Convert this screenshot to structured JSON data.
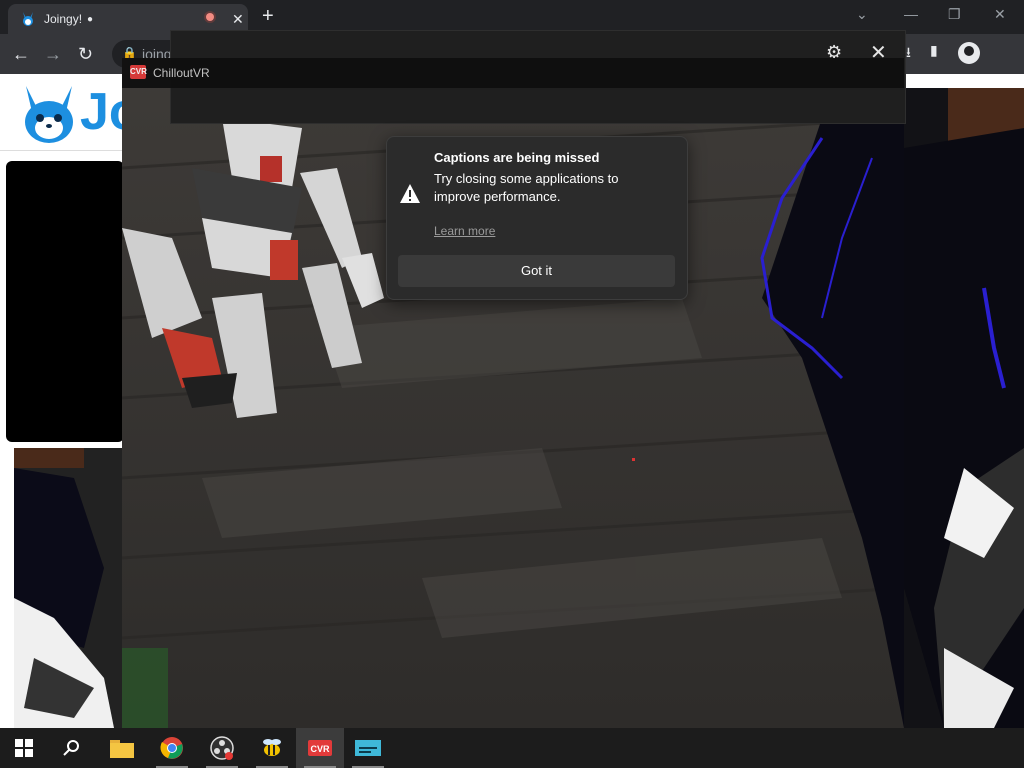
{
  "browser": {
    "tab_title": "Joingy!",
    "tab_chat_icon": "chat-bubble-icon",
    "new_tab": "+",
    "url": "joingy.com"
  },
  "site": {
    "logo_text": "Jo"
  },
  "app_window": {
    "title": "ChilloutVR"
  },
  "notification": {
    "heading": "Captions are being missed",
    "body": "Try closing some applications to improve performance.",
    "learn_more": "Learn more",
    "button": "Got it"
  },
  "taskbar": {
    "items": [
      "windows-start-icon",
      "search-icon",
      "file-explorer-icon",
      "chrome-icon",
      "obs-icon",
      "bee-app-icon",
      "chilloutvr-icon",
      "captions-app-icon"
    ]
  },
  "colors": {
    "accent_blue": "#1d8fe0",
    "recording_red": "#f28b82",
    "cvr_red": "#e23a3a",
    "taskbar": "#1c1c1c"
  }
}
